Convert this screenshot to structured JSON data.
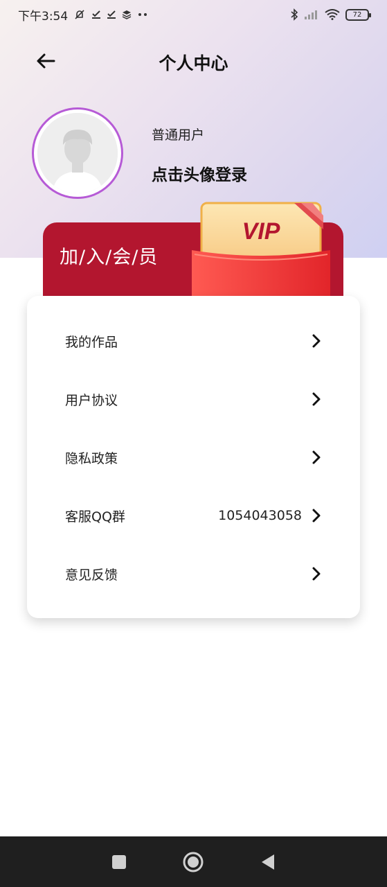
{
  "status_bar": {
    "time": "下午3:54",
    "left_icons": [
      "muted-bell-icon",
      "check-icon",
      "check-icon",
      "layers-icon",
      "more-dots-icon"
    ],
    "right_icons": [
      "bluetooth-icon",
      "signal-icon",
      "wifi-icon"
    ],
    "battery": "72"
  },
  "header": {
    "title": "个人中心",
    "back_icon": "arrow-left-icon"
  },
  "profile": {
    "user_type": "普通用户",
    "login_prompt": "点击头像登录"
  },
  "vip": {
    "join_label": "加/入/会/员",
    "badge_text": "VIP"
  },
  "menu": {
    "items": [
      {
        "label": "我的作品",
        "value": ""
      },
      {
        "label": "用户协议",
        "value": ""
      },
      {
        "label": "隐私政策",
        "value": ""
      },
      {
        "label": "客服QQ群",
        "value": "1054043058"
      },
      {
        "label": "意见反馈",
        "value": ""
      }
    ]
  },
  "colors": {
    "accent_ring": "#b65ad6",
    "vip_banner": "#b3162f",
    "vip_envelope": "#e8393a",
    "nav_bar": "#1f1f1f"
  }
}
